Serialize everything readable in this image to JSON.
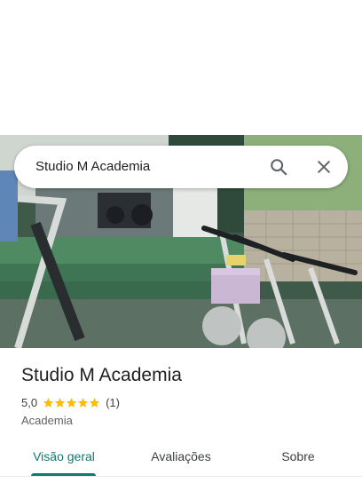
{
  "search": {
    "query": "Studio M Academia",
    "search_icon": "search-icon",
    "close_icon": "close-icon"
  },
  "photo": {
    "icon": "gym-photo"
  },
  "place": {
    "name": "Studio M Academia",
    "rating": "5,0",
    "stars": 5,
    "review_count": "(1)",
    "category": "Academia"
  },
  "tabs": [
    {
      "label": "Visão geral",
      "active": true
    },
    {
      "label": "Avaliações",
      "active": false
    },
    {
      "label": "Sobre",
      "active": false
    }
  ],
  "colors": {
    "accent": "#0b7a75",
    "star": "#fbbc04",
    "text_primary": "#202124",
    "text_secondary": "#5f6368"
  }
}
